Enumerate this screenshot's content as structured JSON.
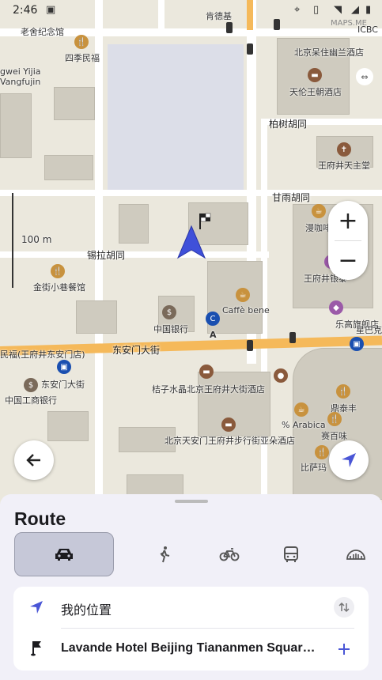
{
  "status_bar": {
    "time": "2:46",
    "maps_me_label": "MAPS.ME"
  },
  "map": {
    "scale_label": "100 m",
    "roads": [
      "锡拉胡同",
      "东安门大街",
      "柏树胡同",
      "甘雨胡同"
    ],
    "places": [
      "老舍纪念馆",
      "四季民福",
      "北京呆住幽兰酒店",
      "天伦王朝酒店",
      "王府井天主堂",
      "漫咖啡",
      "王府井银泰",
      "金街小巷餐馆",
      "中国银行",
      "Caffè bene",
      "A",
      "乐高旗舰店",
      "星巴克",
      "东安门大街",
      "中国工商银行",
      "桔子水晶北京王府井大街酒店",
      "% Arabica",
      "鼎泰丰",
      "赛百味",
      "北京天安门王府井步行街亚朵酒店",
      "比萨玛",
      "ICBC",
      "肯德基",
      "gwei Yijia",
      "Vangfujin",
      "民福(王府井东安门店)"
    ],
    "zoom_in_label": "+",
    "zoom_out_label": "−"
  },
  "route_panel": {
    "title": "Route",
    "modes": [
      {
        "name": "car",
        "icon": "car-icon",
        "active": true
      },
      {
        "name": "walk",
        "icon": "walk-icon",
        "active": false
      },
      {
        "name": "bike",
        "icon": "bike-icon",
        "active": false
      },
      {
        "name": "transit",
        "icon": "bus-icon",
        "active": false
      },
      {
        "name": "ruler",
        "icon": "ruler-icon",
        "active": false
      }
    ],
    "start": {
      "label": "我的位置"
    },
    "destination": {
      "label": "Lavande Hotel Beijing Tiananmen Square ..."
    }
  },
  "colors": {
    "accent": "#4a56d6",
    "route_panel_bg": "#f1f0f8",
    "main_road": "#f5b95a"
  }
}
